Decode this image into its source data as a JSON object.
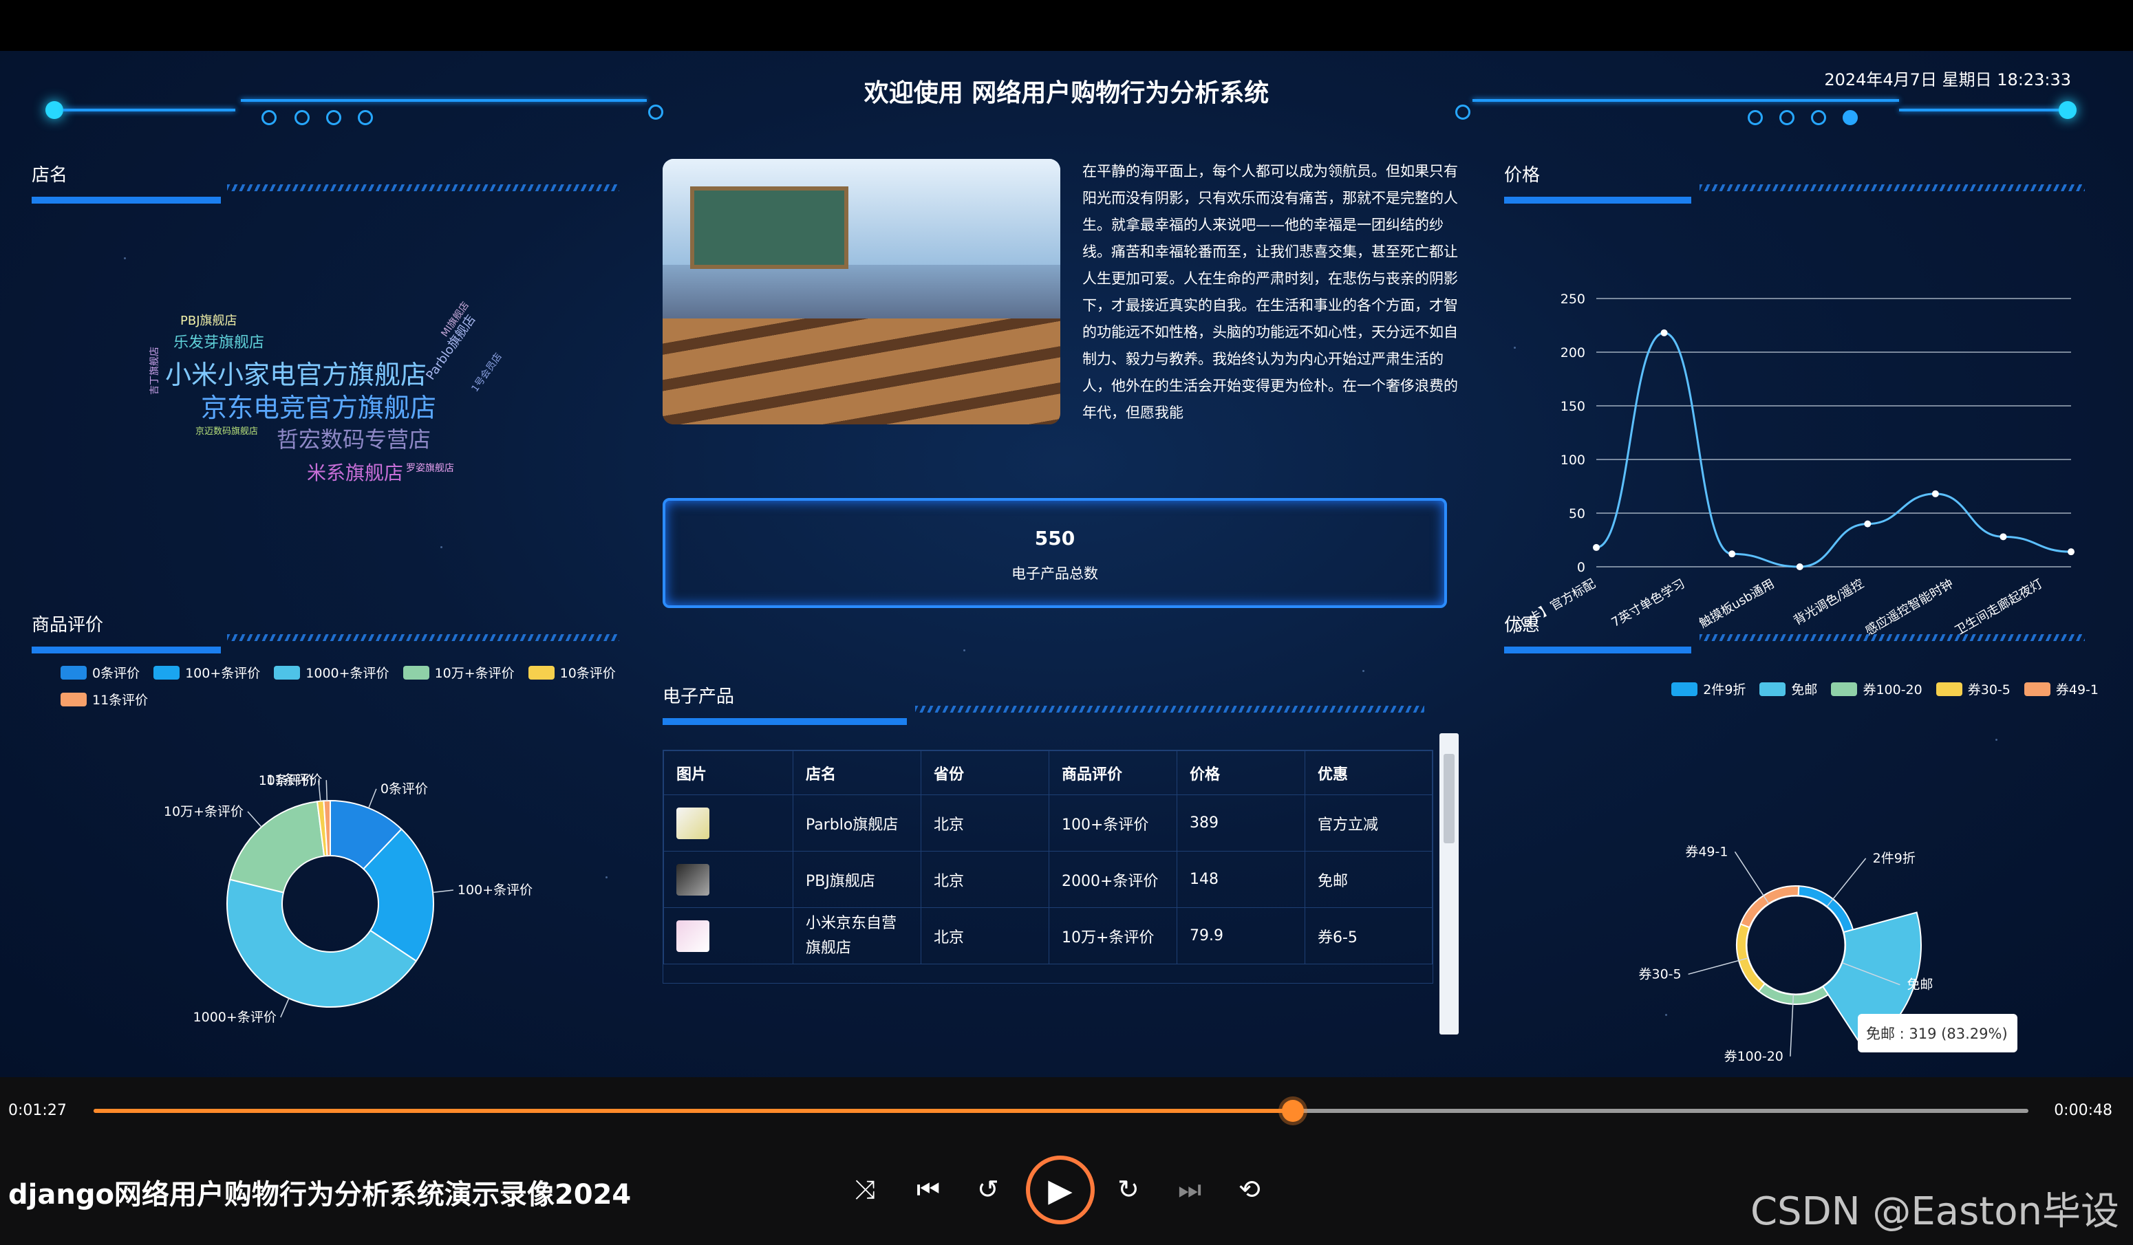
{
  "header": {
    "title": "欢迎使用 网络用户购物行为分析系统",
    "datetime": "2024年4月7日 星期日 18:23:33"
  },
  "panels": {
    "shop_name": "店名",
    "rating": "商品评价",
    "price": "价格",
    "discount": "优惠",
    "products": "电子产品"
  },
  "wordcloud": [
    {
      "text": "小米小家电官方旗舰店",
      "color": "#7fc8ff"
    },
    {
      "text": "京东电竞官方旗舰店",
      "color": "#5aa8ff"
    },
    {
      "text": "哲宏数码专营店",
      "color": "#8e88c6"
    },
    {
      "text": "米系旗舰店",
      "color": "#c86fd8"
    },
    {
      "text": "乐发芽旗舰店",
      "color": "#5fd0d8"
    },
    {
      "text": "PBJ旗舰店",
      "color": "#f0f0a8"
    },
    {
      "text": "Parblo旗舰店",
      "color": "#a8b8f0"
    },
    {
      "text": "京迈数码旗舰店",
      "color": "#b7e07a"
    },
    {
      "text": "罗姿旗舰店",
      "color": "#e8a0f0"
    },
    {
      "text": "MI旗舰店",
      "color": "#c4a8d8"
    },
    {
      "text": "1号会员店",
      "color": "#8aa0e0"
    },
    {
      "text": "吉丁旗舰店",
      "color": "#c7a0e8"
    }
  ],
  "intro_text": "在平静的海平面上，每个人都可以成为领航员。但如果只有阳光而没有阴影，只有欢乐而没有痛苦，那就不是完整的人生。就拿最幸福的人来说吧——他的幸福是一团纠结的纱线。痛苦和幸福轮番而至，让我们悲喜交集，甚至死亡都让人生更加可爱。人在生命的严肃时刻，在悲伤与丧亲的阴影下，才最接近真实的自我。在生活和事业的各个方面，才智的功能远不如性格，头脑的功能远不如心性，天分远不如自制力、毅力与教养。我始终认为为内心开始过严肃生活的人，他外在的生活会开始变得更为俭朴。在一个奢侈浪费的年代，但愿我能",
  "stat": {
    "value": "550",
    "label": "电子产品总数"
  },
  "rating_legend": [
    {
      "label": "0条评价",
      "color": "#1e88e5"
    },
    {
      "label": "100+条评价",
      "color": "#1aa5f0"
    },
    {
      "label": "1000+条评价",
      "color": "#4ec3e8"
    },
    {
      "label": "10万+条评价",
      "color": "#8fd1a8"
    },
    {
      "label": "10条评价",
      "color": "#f6d04d"
    },
    {
      "label": "11条评价",
      "color": "#f7a06a"
    }
  ],
  "discount_legend": [
    {
      "label": "2件9折",
      "color": "#1aa5f0"
    },
    {
      "label": "免邮",
      "color": "#4ec3e8"
    },
    {
      "label": "券100-20",
      "color": "#8fd1a8"
    },
    {
      "label": "券30-5",
      "color": "#f6d04d"
    },
    {
      "label": "券49-1",
      "color": "#f7a06a"
    }
  ],
  "table": {
    "headers": [
      "图片",
      "店名",
      "省份",
      "商品评价",
      "价格",
      "优惠"
    ],
    "rows": [
      {
        "shop": "Parblo旗舰店",
        "province": "北京",
        "rating": "100+条评价",
        "price": "389",
        "discount": "官方立减"
      },
      {
        "shop": "PBJ旗舰店",
        "province": "北京",
        "rating": "2000+条评价",
        "price": "148",
        "discount": "免邮"
      },
      {
        "shop": "小米京东自营旗舰店",
        "province": "北京",
        "rating": "10万+条评价",
        "price": "79.9",
        "discount": "券6-5"
      }
    ]
  },
  "tooltip": "免邮 : 319 (83.29%)",
  "player": {
    "elapsed": "0:01:27",
    "remaining": "0:00:48",
    "progress": 0.62,
    "title": "django网络用户购物行为分析系统演示录像2024",
    "watermark": "CSDN @Easton毕设"
  },
  "chart_data": [
    {
      "type": "pie",
      "title": "商品评价",
      "labels": [
        "0条评价",
        "100+条评价",
        "1000+条评价",
        "10万+条评价",
        "10条评价",
        "11条评价"
      ],
      "values": [
        12,
        22,
        44,
        19,
        1,
        1
      ],
      "colors": [
        "#1e88e5",
        "#1aa5f0",
        "#4ec3e8",
        "#8fd1a8",
        "#f6d04d",
        "#f7a06a"
      ],
      "donut": true,
      "legend": "top"
    },
    {
      "type": "line",
      "title": "价格",
      "ylim": [
        0,
        250
      ],
      "yticks": [
        0,
        50,
        100,
        150,
        200,
        250
      ],
      "x": [
        "64G卡】官方标配",
        "7英寸单色学习",
        "触摸板usb通用",
        "背光调色/遥控",
        "感应遥控智能时钟",
        "卫生间走廊起夜灯"
      ],
      "y": [
        18,
        218,
        12,
        0,
        40,
        68,
        28,
        14
      ],
      "grid": true,
      "smooth": true
    },
    {
      "type": "pie",
      "title": "优惠",
      "labels": [
        "2件9折",
        "免邮",
        "券100-20",
        "券30-5",
        "券49-1"
      ],
      "values": [
        15,
        319,
        20,
        16,
        13
      ],
      "colors": [
        "#1aa5f0",
        "#4ec3e8",
        "#8fd1a8",
        "#f6d04d",
        "#f7a06a"
      ],
      "rose": true,
      "legend": "top-right"
    }
  ]
}
